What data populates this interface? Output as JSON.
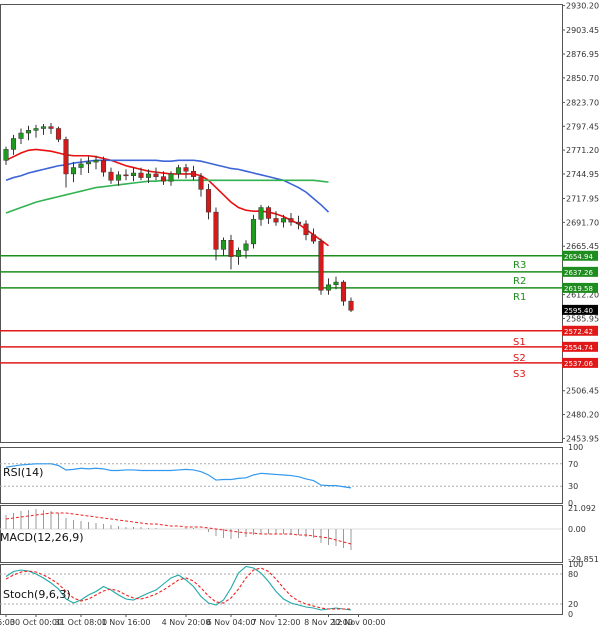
{
  "chart_data": [
    {
      "type": "candlestick",
      "panel": "price",
      "title": "",
      "y_ticks": [
        "2930.20",
        "2903.45",
        "2876.95",
        "2850.70",
        "2823.70",
        "2797.45",
        "2771.20",
        "2744.95",
        "2717.95",
        "2691.70",
        "2665.45",
        "2612.20",
        "2585.95",
        "2506.45",
        "2480.20",
        "2453.95"
      ],
      "x_ticks": [
        "6:00",
        "30 Oct 00:00",
        "31 Oct 08:00",
        "1 Nov 16:00",
        "4 Nov 20:00",
        "6 Nov 04:00",
        "7 Nov 12:00",
        "8 Nov 20:00",
        "12 Nov 00:00"
      ],
      "ylim": [
        2450,
        2932
      ],
      "candles": [
        [
          2760,
          2775,
          2755,
          2772
        ],
        [
          2772,
          2788,
          2766,
          2784
        ],
        [
          2784,
          2795,
          2778,
          2790
        ],
        [
          2790,
          2798,
          2782,
          2793
        ],
        [
          2793,
          2799,
          2785,
          2795
        ],
        [
          2795,
          2800,
          2788,
          2797
        ],
        [
          2797,
          2801,
          2789,
          2795
        ],
        [
          2795,
          2797,
          2780,
          2783
        ],
        [
          2783,
          2786,
          2730,
          2745
        ],
        [
          2745,
          2758,
          2736,
          2752
        ],
        [
          2752,
          2762,
          2744,
          2756
        ],
        [
          2756,
          2764,
          2746,
          2758
        ],
        [
          2758,
          2765,
          2750,
          2760
        ],
        [
          2760,
          2764,
          2742,
          2747
        ],
        [
          2747,
          2752,
          2734,
          2738
        ],
        [
          2738,
          2748,
          2732,
          2744
        ],
        [
          2744,
          2750,
          2738,
          2743
        ],
        [
          2743,
          2752,
          2737,
          2746
        ],
        [
          2746,
          2752,
          2738,
          2741
        ],
        [
          2741,
          2750,
          2735,
          2745
        ],
        [
          2745,
          2752,
          2738,
          2742
        ],
        [
          2742,
          2748,
          2733,
          2737
        ],
        [
          2737,
          2748,
          2732,
          2745
        ],
        [
          2745,
          2755,
          2740,
          2752
        ],
        [
          2752,
          2756,
          2740,
          2748
        ],
        [
          2748,
          2754,
          2738,
          2742
        ],
        [
          2742,
          2746,
          2720,
          2728
        ],
        [
          2728,
          2734,
          2695,
          2703
        ],
        [
          2703,
          2708,
          2650,
          2662
        ],
        [
          2662,
          2675,
          2655,
          2672
        ],
        [
          2672,
          2678,
          2640,
          2654
        ],
        [
          2654,
          2664,
          2645,
          2661
        ],
        [
          2661,
          2672,
          2652,
          2668
        ],
        [
          2668,
          2700,
          2663,
          2695
        ],
        [
          2695,
          2711,
          2688,
          2708
        ],
        [
          2708,
          2710,
          2690,
          2696
        ],
        [
          2696,
          2704,
          2688,
          2692
        ],
        [
          2692,
          2700,
          2686,
          2696
        ],
        [
          2696,
          2702,
          2688,
          2692
        ],
        [
          2692,
          2699,
          2684,
          2690
        ],
        [
          2690,
          2694,
          2672,
          2678
        ],
        [
          2678,
          2685,
          2668,
          2671
        ],
        [
          2671,
          2674,
          2612,
          2617
        ],
        [
          2617,
          2630,
          2612,
          2623
        ],
        [
          2623,
          2632,
          2618,
          2626
        ],
        [
          2626,
          2628,
          2600,
          2605
        ],
        [
          2605,
          2609,
          2593,
          2595
        ]
      ],
      "series": [
        {
          "name": "",
          "color": "#e81010",
          "start": 0,
          "values": [
            2760,
            2764,
            2768,
            2771,
            2772,
            2771,
            2770,
            2768,
            2766,
            2765,
            2765,
            2765,
            2764,
            2762,
            2760,
            2757,
            2754,
            2752,
            2750,
            2748,
            2747,
            2746,
            2745,
            2745,
            2745,
            2745,
            2743,
            2738,
            2730,
            2722,
            2714,
            2708,
            2705,
            2704,
            2704,
            2703,
            2701,
            2698,
            2694,
            2690,
            2684,
            2678,
            2672,
            2666
          ]
        },
        {
          "name": "",
          "color": "#3c64d8",
          "start": 0,
          "values": [
            2738,
            2741,
            2743,
            2746,
            2748,
            2750,
            2752,
            2754,
            2755,
            2757,
            2758,
            2759,
            2760,
            2760,
            2760,
            2760,
            2760,
            2760,
            2760,
            2760,
            2760,
            2759,
            2759,
            2760,
            2760,
            2760,
            2759,
            2757,
            2755,
            2753,
            2751,
            2750,
            2748,
            2746,
            2744,
            2742,
            2740,
            2738,
            2734,
            2730,
            2725,
            2718,
            2711,
            2703
          ]
        },
        {
          "name": "",
          "color": "#32b250",
          "start": 0,
          "values": [
            2702,
            2705,
            2708,
            2711,
            2714,
            2716,
            2718,
            2720,
            2722,
            2724,
            2726,
            2728,
            2730,
            2731,
            2732,
            2733,
            2734,
            2735,
            2736,
            2737,
            2737,
            2738,
            2738,
            2738,
            2738,
            2738,
            2738,
            2738,
            2738,
            2738,
            2738,
            2738,
            2738,
            2738,
            2738,
            2738,
            2738,
            2738,
            2738,
            2738,
            2738,
            2738,
            2737,
            2736
          ]
        }
      ],
      "levels": [
        {
          "label": "R3",
          "value": "2654.94",
          "color": "#1e8c1e"
        },
        {
          "label": "R2",
          "value": "2637.26",
          "color": "#1e8c1e"
        },
        {
          "label": "R1",
          "value": "2619.58",
          "color": "#1e8c1e"
        },
        {
          "label": "S1",
          "value": "2572.42",
          "color": "#e01818"
        },
        {
          "label": "S2",
          "value": "2554.74",
          "color": "#e01818"
        },
        {
          "label": "S3",
          "value": "2537.06",
          "color": "#e01818"
        }
      ],
      "current_price": "2595.40"
    },
    {
      "type": "line",
      "panel": "rsi",
      "name": "RSI(14)",
      "y_ticks": [
        "100",
        "70",
        "30",
        "0"
      ],
      "ylim": [
        0,
        100
      ],
      "levels": [
        70,
        30
      ],
      "color": "#3399ee",
      "values": [
        64,
        66,
        68,
        69,
        70,
        70,
        70,
        67,
        59,
        60,
        62,
        61,
        62,
        61,
        58,
        58,
        59,
        59,
        58,
        58,
        58,
        58,
        58,
        59,
        60,
        59,
        56,
        50,
        41,
        42,
        42,
        44,
        45,
        50,
        53,
        52,
        51,
        50,
        49,
        47,
        43,
        40,
        32,
        31,
        31,
        29,
        27
      ]
    },
    {
      "type": "bar",
      "panel": "macd",
      "name": "MACD(12,26,9)",
      "y_ticks": [
        "21.092",
        "0.00",
        "-29.851"
      ],
      "ylim": [
        -33,
        24
      ],
      "bar_color": "#9a9a9a",
      "signal_color": "#ee2222",
      "hist": [
        14,
        16,
        18,
        19,
        20,
        19,
        18,
        16,
        11,
        9,
        8,
        7,
        6,
        5,
        4,
        3,
        2,
        2,
        2,
        1,
        1,
        0,
        0,
        0,
        1,
        1,
        0,
        -3,
        -7,
        -9,
        -10,
        -9,
        -8,
        -6,
        -5,
        -5,
        -5,
        -5,
        -6,
        -6,
        -8,
        -9,
        -14,
        -16,
        -17,
        -19,
        -21
      ],
      "signal": [
        10,
        11,
        12,
        13,
        14,
        15,
        16,
        16,
        16,
        15,
        14,
        13,
        12,
        11,
        10,
        9,
        8,
        7,
        6,
        5,
        5,
        4,
        3,
        3,
        2,
        2,
        2,
        1,
        0,
        -1,
        -2,
        -3,
        -4,
        -4,
        -5,
        -5,
        -5,
        -5,
        -5,
        -6,
        -6,
        -7,
        -8,
        -9,
        -11,
        -13,
        -15
      ]
    },
    {
      "type": "line",
      "panel": "stoch",
      "name": "Stoch(9,6,3)",
      "y_ticks": [
        "100",
        "80",
        "20",
        "0"
      ],
      "ylim": [
        0,
        100
      ],
      "levels": [
        80,
        20
      ],
      "series": [
        {
          "name": "",
          "color": "#22a8a8",
          "values": [
            75,
            85,
            88,
            86,
            80,
            72,
            62,
            50,
            30,
            22,
            28,
            38,
            45,
            55,
            48,
            38,
            30,
            28,
            35,
            42,
            48,
            60,
            72,
            78,
            68,
            55,
            35,
            22,
            18,
            28,
            52,
            82,
            95,
            92,
            82,
            65,
            45,
            30,
            22,
            18,
            14,
            12,
            8,
            10,
            12,
            10,
            8
          ]
        },
        {
          "name": "",
          "color": "#ee2222",
          "values": [
            70,
            78,
            84,
            86,
            84,
            78,
            70,
            60,
            45,
            32,
            26,
            30,
            38,
            46,
            50,
            46,
            38,
            32,
            30,
            34,
            40,
            48,
            58,
            68,
            72,
            66,
            52,
            36,
            24,
            22,
            32,
            50,
            72,
            88,
            92,
            85,
            70,
            52,
            36,
            26,
            20,
            16,
            12,
            10,
            10,
            10,
            10
          ]
        }
      ]
    }
  ]
}
